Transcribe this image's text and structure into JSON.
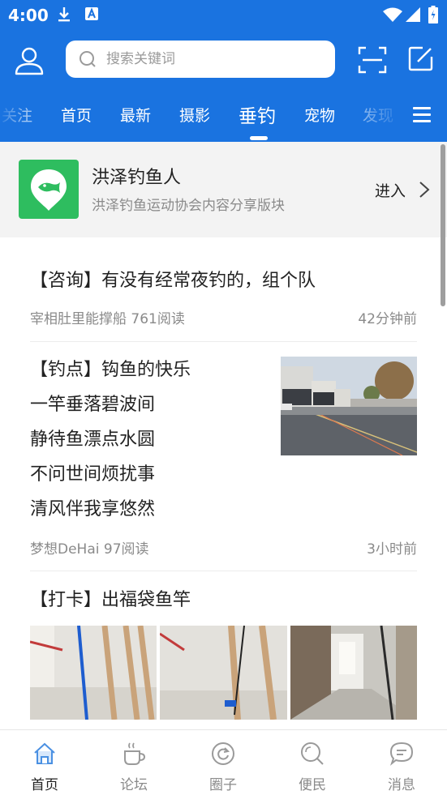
{
  "status_bar": {
    "time": "4:00"
  },
  "search": {
    "placeholder": "搜索关键词"
  },
  "tabs": [
    {
      "label": "关注"
    },
    {
      "label": "首页"
    },
    {
      "label": "最新"
    },
    {
      "label": "摄影"
    },
    {
      "label": "垂钓",
      "active": true
    },
    {
      "label": "宠物"
    },
    {
      "label": "发现"
    }
  ],
  "forum": {
    "name": "洪泽钓鱼人",
    "description": "洪泽钓鱼运动协会内容分享版块",
    "enter_label": "进入"
  },
  "posts": [
    {
      "title": "【咨询】有没有经常夜钓的，组个队",
      "author": "宰相肚里能撑船",
      "reads": "761阅读",
      "time": "42分钟前"
    },
    {
      "title_lines": [
        "【钓点】钩鱼的快乐",
        "一竿垂落碧波间",
        "静待鱼漂点水圆",
        "不问世间烦扰事",
        "清风伴我享悠然"
      ],
      "author": "梦想DeHai",
      "reads": "97阅读",
      "time": "3小时前"
    },
    {
      "title": "【打卡】出福袋鱼竿"
    }
  ],
  "bottom_nav": [
    {
      "label": "首页",
      "icon": "home-icon",
      "active": true
    },
    {
      "label": "论坛",
      "icon": "coffee-cup-icon"
    },
    {
      "label": "圈子",
      "icon": "refresh-circle-icon"
    },
    {
      "label": "便民",
      "icon": "search-icon"
    },
    {
      "label": "消息",
      "icon": "chat-bubble-icon"
    }
  ],
  "colors": {
    "brand_blue": "#1a73e0",
    "forum_green": "#2ebd5f",
    "nav_active": "#4a90e2",
    "nav_inactive": "#9a9a9a"
  }
}
